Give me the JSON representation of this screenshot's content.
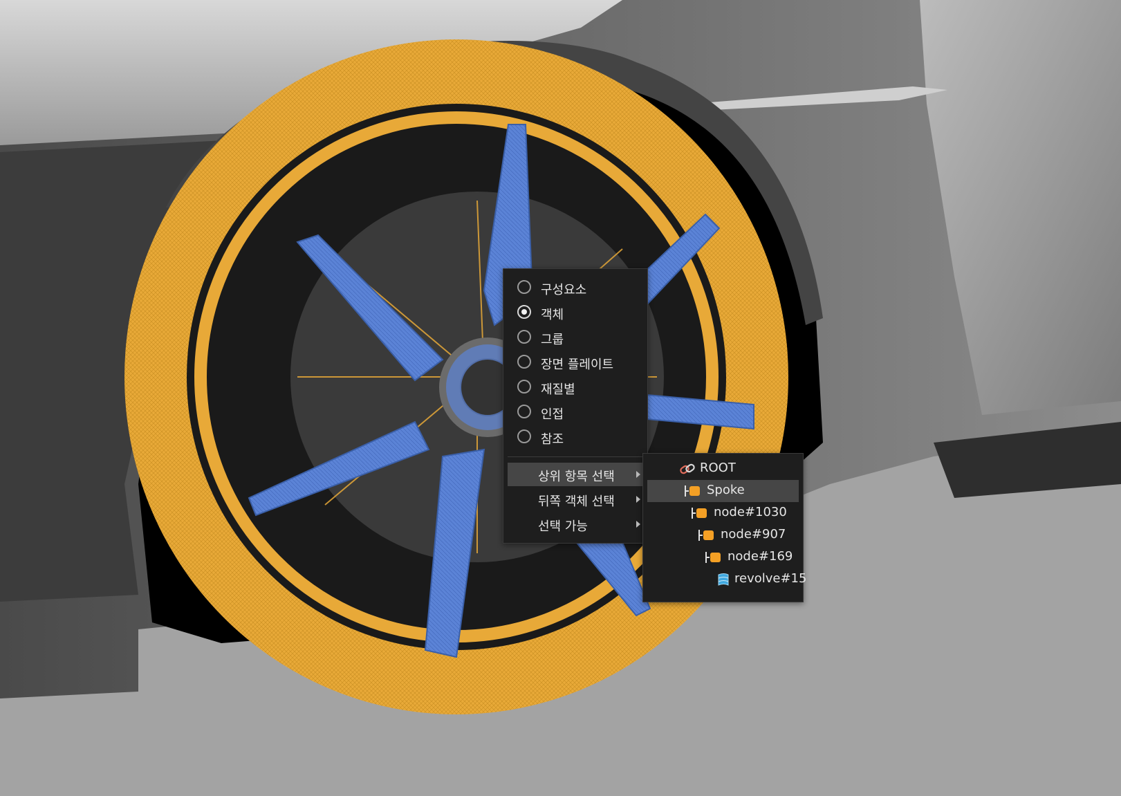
{
  "viewport": {
    "description_colors": {
      "background": "#a3a3a3",
      "body": "#5a5a5a",
      "tire_wireframe": "#e8a938",
      "spoke_wireframe": "#5b83d6",
      "wheel_well": "#000000"
    }
  },
  "context_menu": {
    "selection_modes": [
      {
        "label": "구성요소",
        "checked": false
      },
      {
        "label": "객체",
        "checked": true
      },
      {
        "label": "그룹",
        "checked": false
      },
      {
        "label": "장면 플레이트",
        "checked": false
      },
      {
        "label": "재질별",
        "checked": false
      },
      {
        "label": "인접",
        "checked": false
      },
      {
        "label": "참조",
        "checked": false
      }
    ],
    "submenus": [
      {
        "label": "상위 항목 선택",
        "highlighted": true
      },
      {
        "label": "뒤쪽 객체 선택",
        "highlighted": false
      },
      {
        "label": "선택 가능",
        "highlighted": false
      }
    ]
  },
  "parent_submenu": {
    "items": [
      {
        "label": "ROOT",
        "icon": "link-icon",
        "highlighted": false
      },
      {
        "label": "Spoke",
        "icon": "node-icon",
        "highlighted": true
      },
      {
        "label": "node#1030",
        "icon": "node-icon",
        "highlighted": false
      },
      {
        "label": "node#907",
        "icon": "node-icon",
        "highlighted": false
      },
      {
        "label": "node#169",
        "icon": "node-icon",
        "highlighted": false
      },
      {
        "label": "revolve#15",
        "icon": "surface-icon",
        "highlighted": false
      }
    ]
  }
}
